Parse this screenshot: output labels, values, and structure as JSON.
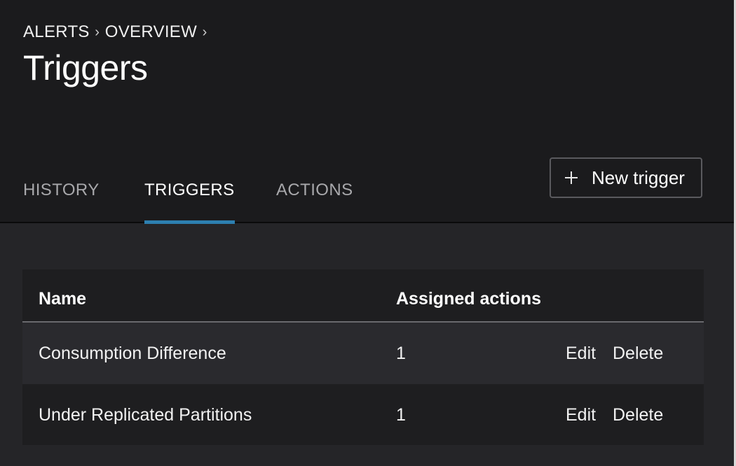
{
  "breadcrumb": [
    "ALERTS",
    "OVERVIEW"
  ],
  "page_title": "Triggers",
  "tabs": [
    {
      "label": "HISTORY",
      "active": false
    },
    {
      "label": "TRIGGERS",
      "active": true
    },
    {
      "label": "ACTIONS",
      "active": false
    }
  ],
  "new_trigger_label": "New trigger",
  "table": {
    "columns": [
      "Name",
      "Assigned actions"
    ],
    "rows": [
      {
        "name": "Consumption Difference",
        "assigned": "1",
        "edit": "Edit",
        "delete": "Delete"
      },
      {
        "name": "Under Replicated Partitions",
        "assigned": "1",
        "edit": "Edit",
        "delete": "Delete"
      }
    ]
  },
  "colors": {
    "header_bg": "#1b1b1d",
    "content_bg": "#252528",
    "accent": "#2d7fb0"
  }
}
